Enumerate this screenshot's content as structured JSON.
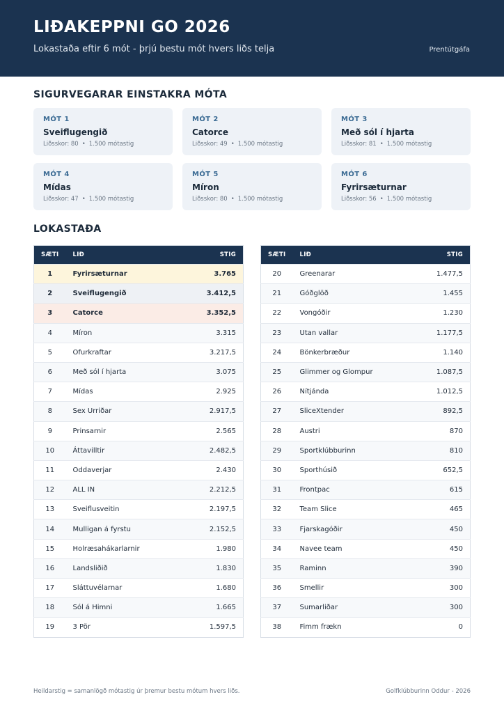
{
  "header": {
    "title": "LIÐAKEPPNI GO 2026",
    "subtitle": "Lokastaða eftir 6 mót - þrjú bestu mót hvers liðs telja",
    "print_label": "Prentútgáfa"
  },
  "winners": {
    "title": "SIGURVEGARAR EINSTAKRA MÓTA",
    "cards": [
      {
        "label": "MÓT 1",
        "team": "Sveiflugengið",
        "score": "Liðsskor: 80",
        "points": "1.500 mótastig"
      },
      {
        "label": "MÓT 2",
        "team": "Catorce",
        "score": "Liðsskor: 49",
        "points": "1.500 mótastig"
      },
      {
        "label": "MÓT 3",
        "team": "Með sól í hjarta",
        "score": "Liðsskor: 81",
        "points": "1.500 mótastig"
      },
      {
        "label": "MÓT 4",
        "team": "Mídas",
        "score": "Liðsskor: 47",
        "points": "1.500 mótastig"
      },
      {
        "label": "MÓT 5",
        "team": "Míron",
        "score": "Liðsskor: 80",
        "points": "1.500 mótastig"
      },
      {
        "label": "MÓT 6",
        "team": "Fyrirsæturnar",
        "score": "Liðsskor: 56",
        "points": "1.500 mótastig"
      }
    ]
  },
  "standings": {
    "title": "LOKASTAÐA",
    "headers": {
      "rank": "SÆTI",
      "team": "LIÐ",
      "points": "STIG"
    },
    "left": [
      {
        "rank": "1",
        "team": "Fyrirsæturnar",
        "points": "3.765"
      },
      {
        "rank": "2",
        "team": "Sveiflugengið",
        "points": "3.412,5"
      },
      {
        "rank": "3",
        "team": "Catorce",
        "points": "3.352,5"
      },
      {
        "rank": "4",
        "team": "Míron",
        "points": "3.315"
      },
      {
        "rank": "5",
        "team": "Ofurkraftar",
        "points": "3.217,5"
      },
      {
        "rank": "6",
        "team": "Með sól í hjarta",
        "points": "3.075"
      },
      {
        "rank": "7",
        "team": "Mídas",
        "points": "2.925"
      },
      {
        "rank": "8",
        "team": "Sex Urriðar",
        "points": "2.917,5"
      },
      {
        "rank": "9",
        "team": "Prinsarnir",
        "points": "2.565"
      },
      {
        "rank": "10",
        "team": "Áttavilltir",
        "points": "2.482,5"
      },
      {
        "rank": "11",
        "team": "Oddaverjar",
        "points": "2.430"
      },
      {
        "rank": "12",
        "team": "ALL IN",
        "points": "2.212,5"
      },
      {
        "rank": "13",
        "team": "Sveiflusveitin",
        "points": "2.197,5"
      },
      {
        "rank": "14",
        "team": "Mulligan á fyrstu",
        "points": "2.152,5"
      },
      {
        "rank": "15",
        "team": "Holræsahákarlarnir",
        "points": "1.980"
      },
      {
        "rank": "16",
        "team": "Landsliðið",
        "points": "1.830"
      },
      {
        "rank": "17",
        "team": "Sláttuvélarnar",
        "points": "1.680"
      },
      {
        "rank": "18",
        "team": "Sól á Himni",
        "points": "1.665"
      },
      {
        "rank": "19",
        "team": "3 Pör",
        "points": "1.597,5"
      }
    ],
    "right": [
      {
        "rank": "20",
        "team": "Greenarar",
        "points": "1.477,5"
      },
      {
        "rank": "21",
        "team": "Góðglöð",
        "points": "1.455"
      },
      {
        "rank": "22",
        "team": "Vongóðir",
        "points": "1.230"
      },
      {
        "rank": "23",
        "team": "Utan vallar",
        "points": "1.177,5"
      },
      {
        "rank": "24",
        "team": "Bönkerbræður",
        "points": "1.140"
      },
      {
        "rank": "25",
        "team": "Glimmer og Glompur",
        "points": "1.087,5"
      },
      {
        "rank": "26",
        "team": "Nítjánda",
        "points": "1.012,5"
      },
      {
        "rank": "27",
        "team": "SliceXtender",
        "points": "892,5"
      },
      {
        "rank": "28",
        "team": "Austri",
        "points": "870"
      },
      {
        "rank": "29",
        "team": "Sportklúbburinn",
        "points": "810"
      },
      {
        "rank": "30",
        "team": "Sporthúsið",
        "points": "652,5"
      },
      {
        "rank": "31",
        "team": "Frontpac",
        "points": "615"
      },
      {
        "rank": "32",
        "team": "Team Slice",
        "points": "465"
      },
      {
        "rank": "33",
        "team": "Fjarskagóðir",
        "points": "450"
      },
      {
        "rank": "34",
        "team": "Navee team",
        "points": "450"
      },
      {
        "rank": "35",
        "team": "Raminn",
        "points": "390"
      },
      {
        "rank": "36",
        "team": "Smellir",
        "points": "300"
      },
      {
        "rank": "37",
        "team": "Sumarliðar",
        "points": "300"
      },
      {
        "rank": "38",
        "team": "Fimm frækn",
        "points": "0"
      }
    ]
  },
  "footer": {
    "note": "Heildarstig = samanlögð mótastig úr þremur bestu mótum hvers liðs.",
    "credit": "Golfklúbburinn Oddur - 2026"
  }
}
